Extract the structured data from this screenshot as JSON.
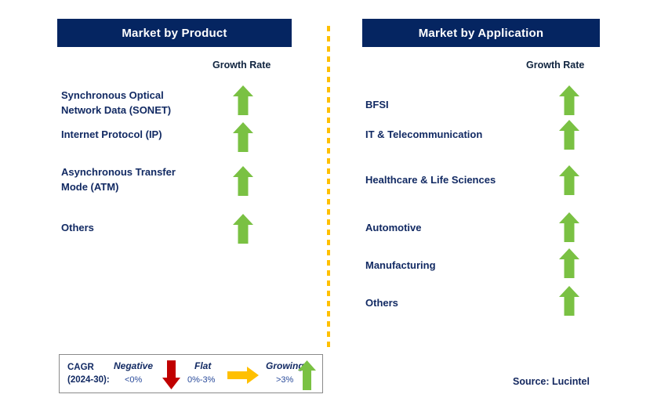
{
  "figure": {
    "divider_color": "#ffc000",
    "header_bg": "#052561",
    "label_color": "#122a63",
    "arrow_growing_color": "#7ac143",
    "arrow_flat_color": "#ffc000",
    "arrow_negative_color": "#c00000"
  },
  "columns": [
    {
      "title": "Market by Product",
      "growth_rate_header": "Growth Rate",
      "rows": [
        {
          "label": "Synchronous Optical\nNetwork Data (SONET)",
          "growth": "Growing",
          "icon": "arrow-up-icon"
        },
        {
          "label": "Internet Protocol (IP)",
          "growth": "Growing",
          "icon": "arrow-up-icon"
        },
        {
          "label": "Asynchronous Transfer\nMode (ATM)",
          "growth": "Growing",
          "icon": "arrow-up-icon"
        },
        {
          "label": "Others",
          "growth": "Growing",
          "icon": "arrow-up-icon"
        }
      ]
    },
    {
      "title": "Market by Application",
      "growth_rate_header": "Growth Rate",
      "rows": [
        {
          "label": "BFSI",
          "growth": "Growing",
          "icon": "arrow-up-icon"
        },
        {
          "label": "IT & Telecommunication",
          "growth": "Growing",
          "icon": "arrow-up-icon"
        },
        {
          "label": "Healthcare & Life Sciences",
          "growth": "Growing",
          "icon": "arrow-up-icon"
        },
        {
          "label": "Automotive",
          "growth": "Growing",
          "icon": "arrow-up-icon"
        },
        {
          "label": "Manufacturing",
          "growth": "Growing",
          "icon": "arrow-up-icon"
        },
        {
          "label": "Others",
          "growth": "Growing",
          "icon": "arrow-up-icon"
        }
      ]
    }
  ],
  "legend": {
    "cagr_line1": "CAGR",
    "cagr_line2": "(2024-30):",
    "items": [
      {
        "title": "Negative",
        "range": "<0%",
        "icon": "arrow-down-icon",
        "color": "#c00000"
      },
      {
        "title": "Flat",
        "range": "0%-3%",
        "icon": "arrow-right-icon",
        "color": "#ffc000"
      },
      {
        "title": "Growing",
        "range": ">3%",
        "icon": "arrow-up-icon",
        "color": "#7ac143"
      }
    ]
  },
  "source": "Source: Lucintel"
}
